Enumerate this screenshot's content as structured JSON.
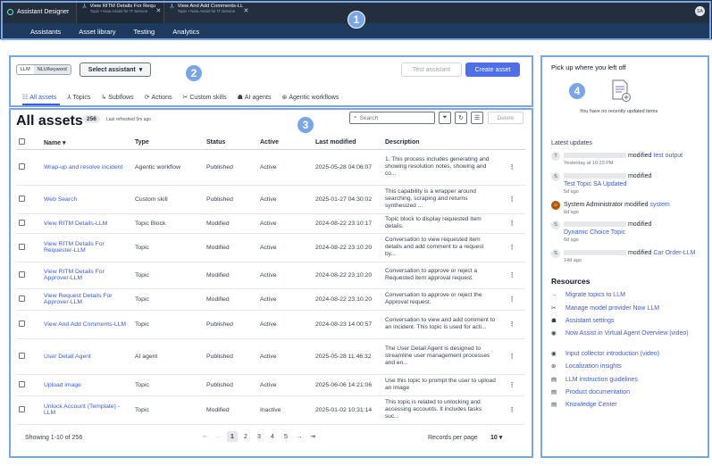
{
  "app": {
    "brand": "Assistant Designer",
    "avatar": "SA"
  },
  "tabs": [
    {
      "title": "View RITM Details For Requ",
      "sub": "Topic • Now Assist for IT Service"
    },
    {
      "title": "View And Add Comments-LL",
      "sub": "Topic • Now Assist for IT Service"
    }
  ],
  "nav": [
    "Assistants",
    "Asset library",
    "Testing",
    "Analytics"
  ],
  "badges": [
    "1",
    "2",
    "3",
    "4"
  ],
  "toolbar": {
    "toggle_llm": "LLM",
    "toggle_nlu": "NLU/keyword",
    "select_assistant": "Select assistant",
    "test_assistant": "Test assistant",
    "create_asset": "Create asset"
  },
  "filters": [
    "All assets",
    "Topics",
    "Subflows",
    "Actions",
    "Custom skills",
    "AI agents",
    "Agentic workflows"
  ],
  "assets": {
    "title": "All assets",
    "count": "256",
    "refreshed": "Last refreshed 5m ago",
    "search_placeholder": "Search",
    "delete": "Delete",
    "columns": [
      "Name",
      "Type",
      "Status",
      "Active",
      "Last modified",
      "Description"
    ],
    "rows": [
      {
        "name": "Wrap-up and resolve incident",
        "type": "Agentic workflow",
        "status": "Published",
        "active": "Active",
        "modified": "2025-05-28 04:06:07",
        "desc": "1. This process includes generating and showing resolution notes, showing and co..."
      },
      {
        "name": "Web Search",
        "type": "Custom skill",
        "status": "Published",
        "active": "Active",
        "modified": "2025-01-27 04:30:02",
        "desc": "This capability is a wrapper around searching, scraping and returns synthesized ..."
      },
      {
        "name": "View RITM Details-LLM",
        "type": "Topic Block",
        "status": "Modified",
        "active": "Active",
        "modified": "2024-08-22 23:10:17",
        "desc": "Topic block to display requested item details."
      },
      {
        "name": "View RITM Details For Requester-LLM",
        "type": "Topic",
        "status": "Modified",
        "active": "Active",
        "modified": "2024-08-22 23:10:20",
        "desc": "Conversation to view requested item details and add comment to a request by..."
      },
      {
        "name": "View RITM Details For Approver-LLM",
        "type": "Topic",
        "status": "Modified",
        "active": "Active",
        "modified": "2024-08-22 23:10:20",
        "desc": "Conversation to approve or reject a Requested item approval request."
      },
      {
        "name": "View Request Details For Approver-LLM",
        "type": "Topic",
        "status": "Modified",
        "active": "Active",
        "modified": "2024-08-22 23:10:20",
        "desc": "Conversation to approve or reject the Approval request."
      },
      {
        "name": "View And Add Comments-LLM",
        "type": "Topic",
        "status": "Published",
        "active": "Active",
        "modified": "2024-08-23 14:00:57",
        "desc": "Conversation to view and add comment to an incident. This topic is used for acti..."
      },
      {
        "name": "User Detail Agent",
        "type": "AI agent",
        "status": "Published",
        "active": "Active",
        "modified": "2025-05-28 11:46:32",
        "desc": "The User Detail Agent is designed to streamline user management processes and en..."
      },
      {
        "name": "Upload image",
        "type": "Topic",
        "status": "Published",
        "active": "Active",
        "modified": "2025-06-06 14:21:06",
        "desc": "Use this topic to prompt the user to upload an image"
      },
      {
        "name": "Unlock Account (Template) - LLM",
        "type": "Topic",
        "status": "Modified",
        "active": "Inactive",
        "modified": "2025-01-02 10:31:14",
        "desc": "This topic is related to unlocking and accessing accounts. It includes tasks suc..."
      }
    ],
    "showing": "Showing 1-10 of 256",
    "pages": [
      "1",
      "2",
      "3",
      "4",
      "5"
    ],
    "rpp_label": "Records per page",
    "rpp_value": "10"
  },
  "side": {
    "pickup": "Pick up where you left off",
    "no_items": "You have no recently updated items",
    "latest": "Latest updates",
    "updates": [
      {
        "av": "T",
        "who": "",
        "verb": "modified",
        "link": "test output",
        "time": "Yesterday at 10:23 PM"
      },
      {
        "av": "S",
        "who": "",
        "verb": "modified",
        "link": "Test Topic SA Updated",
        "time": "5d ago"
      },
      {
        "av": "",
        "who": "System Administrator",
        "verb": "modified",
        "link": "system",
        "time": "6d ago"
      },
      {
        "av": "S",
        "who": "",
        "verb": "modified",
        "link": "Dynamic Choice Topic",
        "time": "6d ago"
      },
      {
        "av": "S",
        "who": "",
        "verb": "modified",
        "link": "Car Order-LLM",
        "time": "14d ago"
      }
    ],
    "resources_title": "Resources",
    "resources": [
      "Migrate topics to LLM",
      "Manage model provider Now LLM",
      "Assistant settings",
      "Now Assist in Virtual Agent Overview (video)",
      "Input collector introduction (video)",
      "Localization insights",
      "LLM instruction guidelines",
      "Product documentation",
      "Knowledge Center"
    ]
  }
}
